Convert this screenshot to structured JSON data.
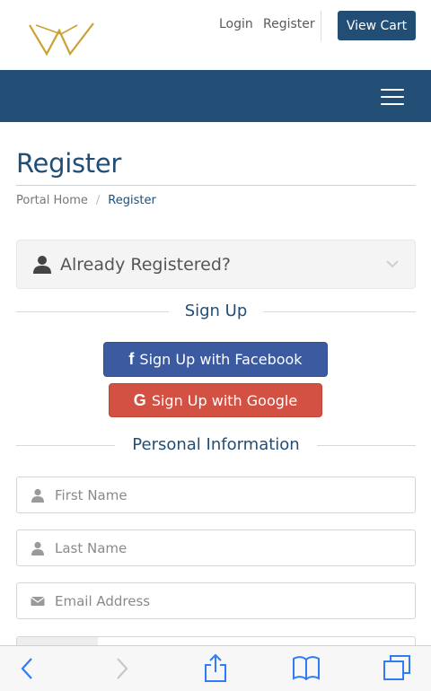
{
  "header": {
    "login_label": "Login",
    "register_label": "Register",
    "view_cart_label": "View Cart",
    "logo_icon": "w-logo-icon"
  },
  "navbar": {
    "menu_icon": "hamburger-menu-icon",
    "color": "#224e75"
  },
  "page": {
    "title": "Register",
    "breadcrumb": [
      {
        "label": "Portal Home"
      },
      {
        "label": "Register"
      }
    ]
  },
  "already_registered": {
    "label": "Already Registered?"
  },
  "signup": {
    "heading": "Sign Up",
    "facebook_label": "Sign Up with Facebook",
    "google_label": "Sign Up with Google"
  },
  "personal_info": {
    "heading": "Personal Information",
    "first_name_placeholder": "First Name",
    "last_name_placeholder": "Last Name",
    "email_placeholder": "Email Address"
  },
  "colors": {
    "accent": "#224e75",
    "facebook": "#3b5aa0",
    "google": "#d35142",
    "logo_gold": "#c9a233"
  }
}
